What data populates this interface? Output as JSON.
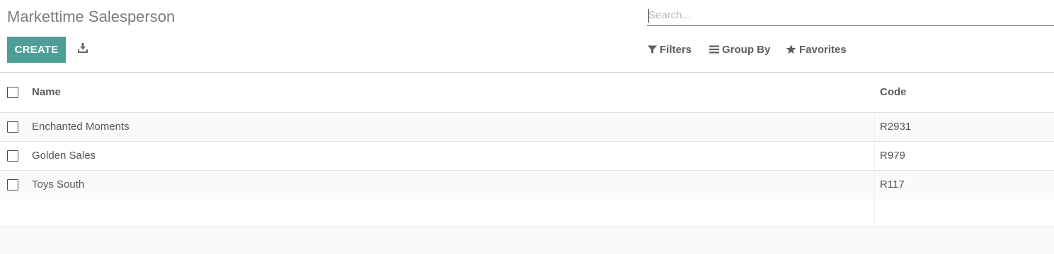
{
  "page": {
    "title": "Markettime Salesperson"
  },
  "toolbar": {
    "create_label": "CREATE",
    "download_icon": "download-icon"
  },
  "search": {
    "placeholder": "Search...",
    "value": ""
  },
  "filters": {
    "filters_label": "Filters",
    "filters_icon": "filter-icon",
    "group_by_label": "Group By",
    "group_by_icon": "list-bars-icon",
    "favorites_label": "Favorites",
    "favorites_icon": "star-icon"
  },
  "table": {
    "columns": [
      "Name",
      "Code"
    ],
    "rows": [
      {
        "name": "Enchanted Moments",
        "code": "R2931"
      },
      {
        "name": "Golden Sales",
        "code": "R979"
      },
      {
        "name": "Toys South",
        "code": "R117"
      }
    ]
  },
  "colors": {
    "accent": "#4e9e97",
    "header_text": "#5e5e5e",
    "title_text": "#7c7c7c"
  }
}
